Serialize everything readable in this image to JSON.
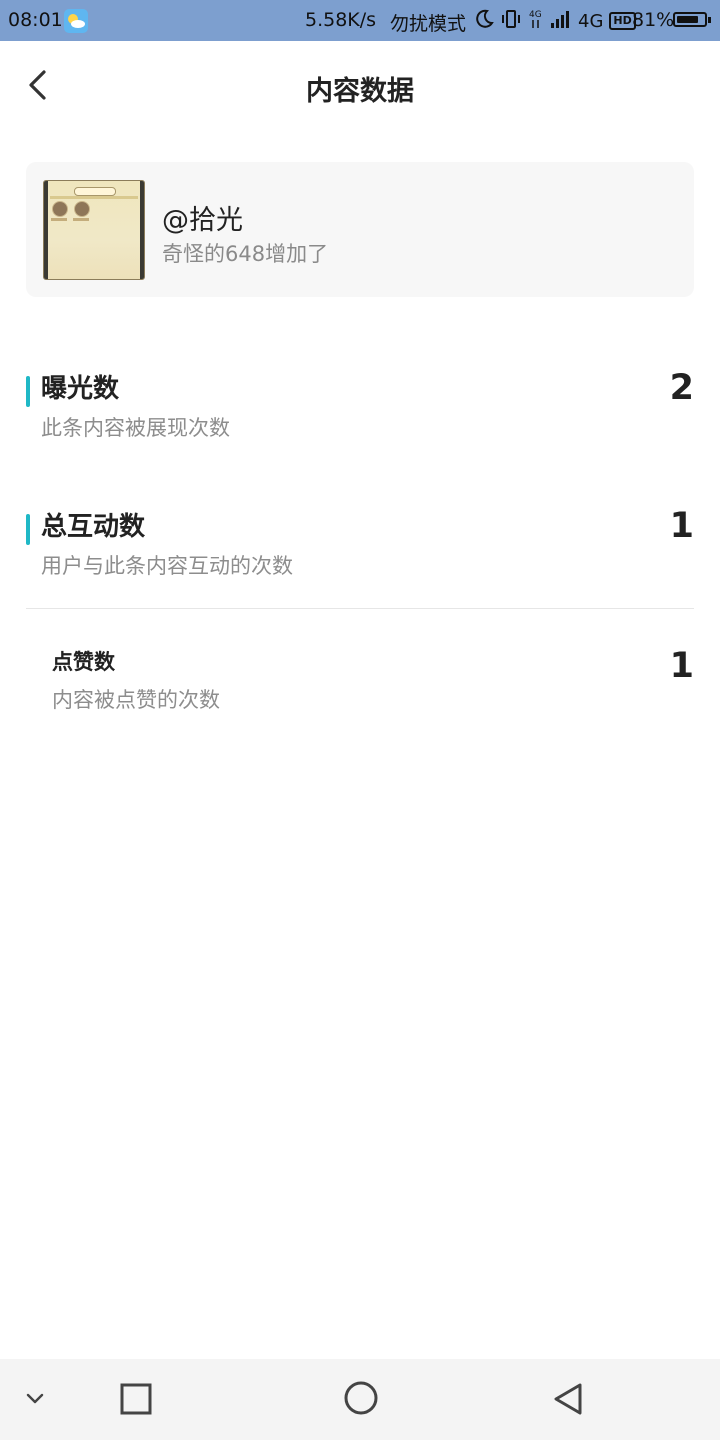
{
  "status_bar": {
    "time": "08:01",
    "net_speed": "5.58K/s",
    "mode": "勿扰模式",
    "network": "4G",
    "hd": "HD",
    "battery_percent_text": "81%",
    "battery_level": 0.81,
    "icons": [
      "weather-icon",
      "moon-icon",
      "vibrate-icon",
      "data-4g-icon",
      "signal-icon",
      "hd-icon",
      "battery-icon"
    ]
  },
  "header": {
    "title": "内容数据",
    "back_icon": "chevron-left-icon"
  },
  "content_card": {
    "author": "@拾光",
    "description": "奇怪的648增加了"
  },
  "metrics": [
    {
      "title": "曝光数",
      "description": "此条内容被展现次数",
      "value": "2"
    },
    {
      "title": "总互动数",
      "description": "用户与此条内容互动的次数",
      "value": "1"
    }
  ],
  "sub_metrics": [
    {
      "title": "点赞数",
      "description": "内容被点赞的次数",
      "value": "1"
    }
  ],
  "colors": {
    "status_bar_bg": "#7d9fcf",
    "accent": "#1fb8c6",
    "muted_text": "#8d8d8d"
  },
  "nav_bar": {
    "buttons": [
      "chevron-down-icon",
      "square-icon",
      "circle-icon",
      "triangle-back-icon"
    ]
  }
}
